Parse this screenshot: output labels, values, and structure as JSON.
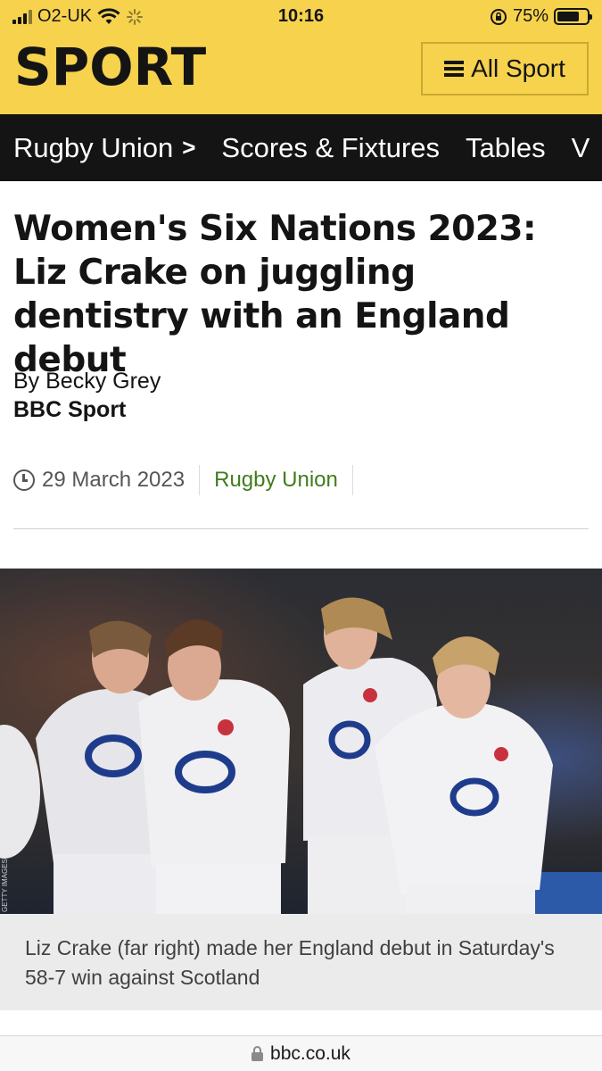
{
  "status_bar": {
    "carrier": "O2-UK",
    "time": "10:16",
    "battery_percent": "75%",
    "battery_level": 0.75
  },
  "header": {
    "logo": "SPORT",
    "menu_label": "All Sport",
    "colors": {
      "brand_yellow": "#f6d24d",
      "nav_black": "#141414"
    }
  },
  "nav": {
    "items": [
      {
        "label": "Rugby Union"
      },
      {
        "label": "Scores & Fixtures"
      },
      {
        "label": "Tables"
      },
      {
        "label": "V"
      }
    ]
  },
  "article": {
    "headline": "Women's Six Nations 2023: Liz Crake on juggling dentistry with an England debut",
    "byline": "By Becky Grey",
    "org": "BBC Sport",
    "date": "29 March 2023",
    "topic": "Rugby Union",
    "topic_color": "#407c1d",
    "image_caption": "Liz Crake (far right) made her England debut in Saturday's 58-7 win against Scotland",
    "image_credit": "GETTY IMAGES"
  },
  "browser": {
    "url": "bbc.co.uk"
  }
}
